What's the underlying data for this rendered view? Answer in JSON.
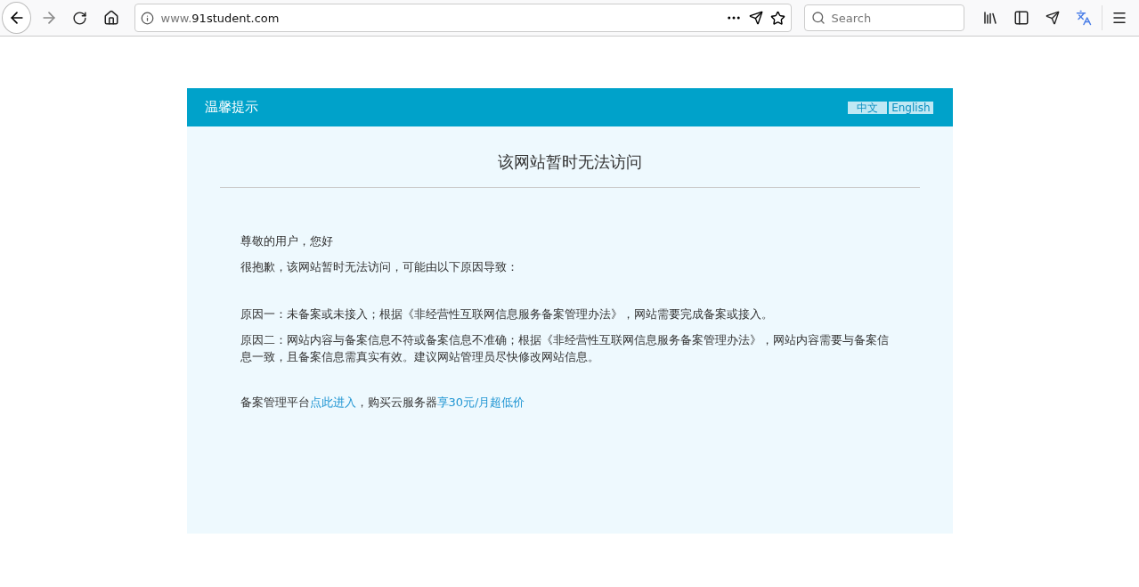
{
  "browser": {
    "url_prefix": "www.",
    "url_domain": "91student.com",
    "search_placeholder": "Search"
  },
  "notice": {
    "title": "温馨提示",
    "languages": [
      {
        "label": "中文"
      },
      {
        "label": "English"
      }
    ],
    "heading": "该网站暂时无法访问",
    "greeting": "尊敬的用户，您好",
    "intro": "很抱歉，该网站暂时无法访问，可能由以下原因导致：",
    "reasons": [
      "原因一：未备案或未接入；根据《非经营性互联网信息服务备案管理办法》，网站需要完成备案或接入。",
      "原因二：网站内容与备案信息不符或备案信息不准确；根据《非经营性互联网信息服务备案管理办法》，网站内容需要与备案信息一致，且备案信息需真实有效。建议网站管理员尽快修改网站信息。"
    ],
    "footer": [
      {
        "kind": "text",
        "text": "备案管理平台"
      },
      {
        "kind": "link",
        "text": "点此进入"
      },
      {
        "kind": "text",
        "text": "，购买云服务器"
      },
      {
        "kind": "link",
        "text": "享30元/月超低价"
      }
    ]
  }
}
